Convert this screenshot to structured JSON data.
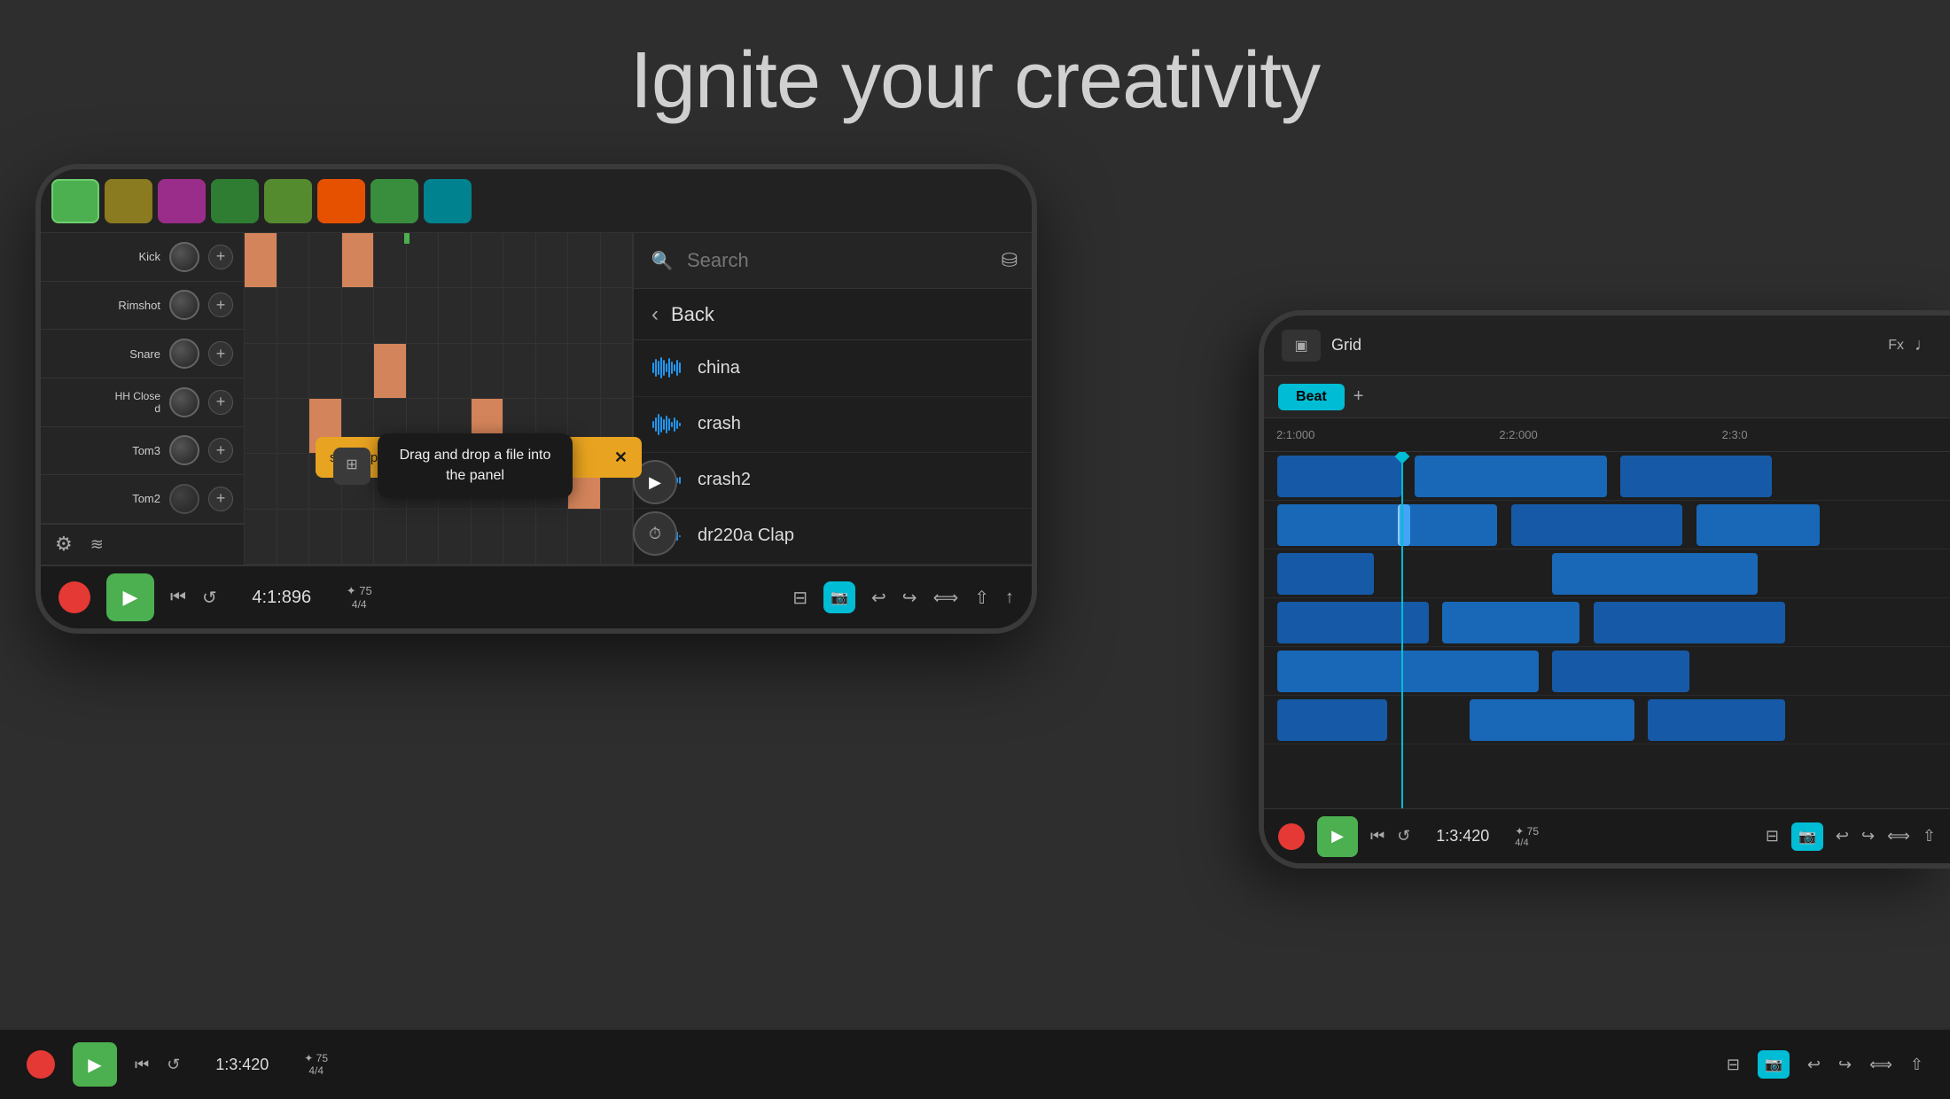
{
  "hero": {
    "title": "Ignite your creativity"
  },
  "pattern_blocks": [
    {
      "color": "active",
      "label": "active"
    },
    {
      "color": "olive",
      "label": "olive"
    },
    {
      "color": "purple",
      "label": "purple"
    },
    {
      "color": "green1",
      "label": "green1"
    },
    {
      "color": "green2",
      "label": "green2"
    },
    {
      "color": "orange",
      "label": "orange"
    },
    {
      "color": "green3",
      "label": "green3"
    },
    {
      "color": "teal",
      "label": "teal"
    }
  ],
  "tracks": [
    {
      "name": "Kick"
    },
    {
      "name": "Rimshot"
    },
    {
      "name": "Snare"
    },
    {
      "name": "HH Close\nd"
    },
    {
      "name": "Tom3"
    },
    {
      "name": "Tom2"
    }
  ],
  "search": {
    "placeholder": "Search"
  },
  "sound_list": [
    {
      "name": "china"
    },
    {
      "name": "crash"
    },
    {
      "name": "crash2"
    },
    {
      "name": "dr220a Clap"
    }
  ],
  "back_label": "Back",
  "transport": {
    "time": "4:1:896",
    "tempo_top": "✦ 75",
    "tempo_bot": "4/4"
  },
  "tooltip": {
    "text": "Drag and drop a file into the panel"
  },
  "notification": {
    "text": "sound-packs in the Add-on manager"
  },
  "right_device": {
    "grid_label": "Grid",
    "fx_label": "Fx",
    "beat_label": "Beat",
    "ruler_marks": [
      "2:1:000",
      "2:2:000",
      "2:3:0"
    ],
    "transport_time": "1:3:420",
    "tempo_top": "✦ 75",
    "tempo_bot": "4/4"
  }
}
